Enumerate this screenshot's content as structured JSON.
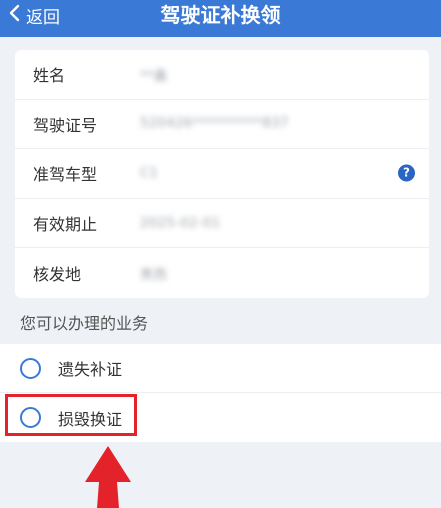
{
  "nav": {
    "back_label": "返回",
    "title": "驾驶证补换领"
  },
  "license": {
    "rows": [
      {
        "label": "姓名",
        "value": "**鑫"
      },
      {
        "label": "驾驶证号",
        "value": "520426**********837"
      },
      {
        "label": "准驾车型",
        "value": "C1"
      },
      {
        "label": "有效期止",
        "value": "2025-02-01"
      },
      {
        "label": "核发地",
        "value": "贵西"
      }
    ]
  },
  "services": {
    "title": "您可以办理的业务",
    "options": [
      {
        "label": "遗失补证"
      },
      {
        "label": "损毁换证"
      }
    ]
  },
  "colors": {
    "primary": "#3a7ad6",
    "highlight": "#e32229"
  },
  "icons": {
    "back": "chevron-left-icon",
    "help": "question-circle-icon",
    "pointer": "arrow-up-icon"
  }
}
